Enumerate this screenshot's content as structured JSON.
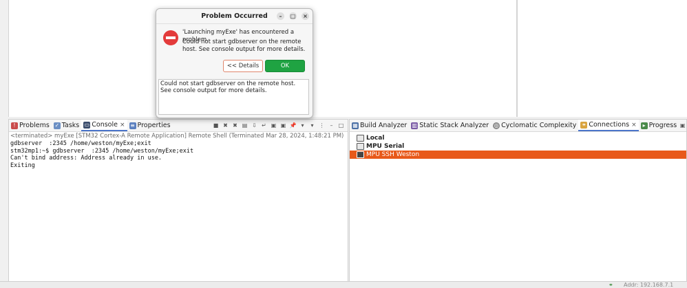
{
  "dialog": {
    "title": "Problem Occurred",
    "minimize_glyph": "–",
    "maximize_glyph": "□",
    "close_glyph": "×",
    "message_line1": "'Launching myExe' has encountered a problem.",
    "message_line2": "Could not start gdbserver on the remote host. See console output for more details.",
    "details_button": "<< Details",
    "ok_button": "OK",
    "details_text": "Could not start gdbserver on the remote host. See console output for more details."
  },
  "console_view": {
    "tabs": [
      {
        "label": "Problems",
        "icon": "problems-icon"
      },
      {
        "label": "Tasks",
        "icon": "tasks-icon"
      },
      {
        "label": "Console",
        "icon": "console-icon",
        "active": true,
        "close": "×"
      },
      {
        "label": "Properties",
        "icon": "properties-icon"
      }
    ],
    "header": "<terminated> myExe [STM32 Cortex-A Remote Application] Remote Shell (Terminated Mar 28, 2024, 1:48:21 PM)",
    "lines": [
      "gdbserver  :2345 /home/weston/myExe;exit",
      "",
      "stm32mp1:~$ gdbserver  :2345 /home/weston/myExe;exit",
      "Can't bind address: Address already in use.",
      "Exiting"
    ]
  },
  "connections_view": {
    "tabs": [
      {
        "label": "Build Analyzer",
        "icon": "build-analyzer-icon"
      },
      {
        "label": "Static Stack Analyzer",
        "icon": "stack-analyzer-icon"
      },
      {
        "label": "Cyclomatic Complexity",
        "icon": "complexity-icon"
      },
      {
        "label": "Connections",
        "icon": "connections-icon",
        "active": true,
        "close": "×"
      },
      {
        "label": "Progress",
        "icon": "progress-icon"
      }
    ],
    "items": [
      {
        "label": "Local",
        "selected": false
      },
      {
        "label": "MPU Serial",
        "selected": false
      },
      {
        "label": "MPU SSH Weston",
        "selected": true
      }
    ]
  },
  "statusbar": {
    "addr": "Addr: 192.168.7.1"
  },
  "colors": {
    "selection": "#e8591a",
    "ok_button": "#1fa342",
    "error_icon": "#e33b3b",
    "active_tab_underline": "#4a74c9"
  }
}
